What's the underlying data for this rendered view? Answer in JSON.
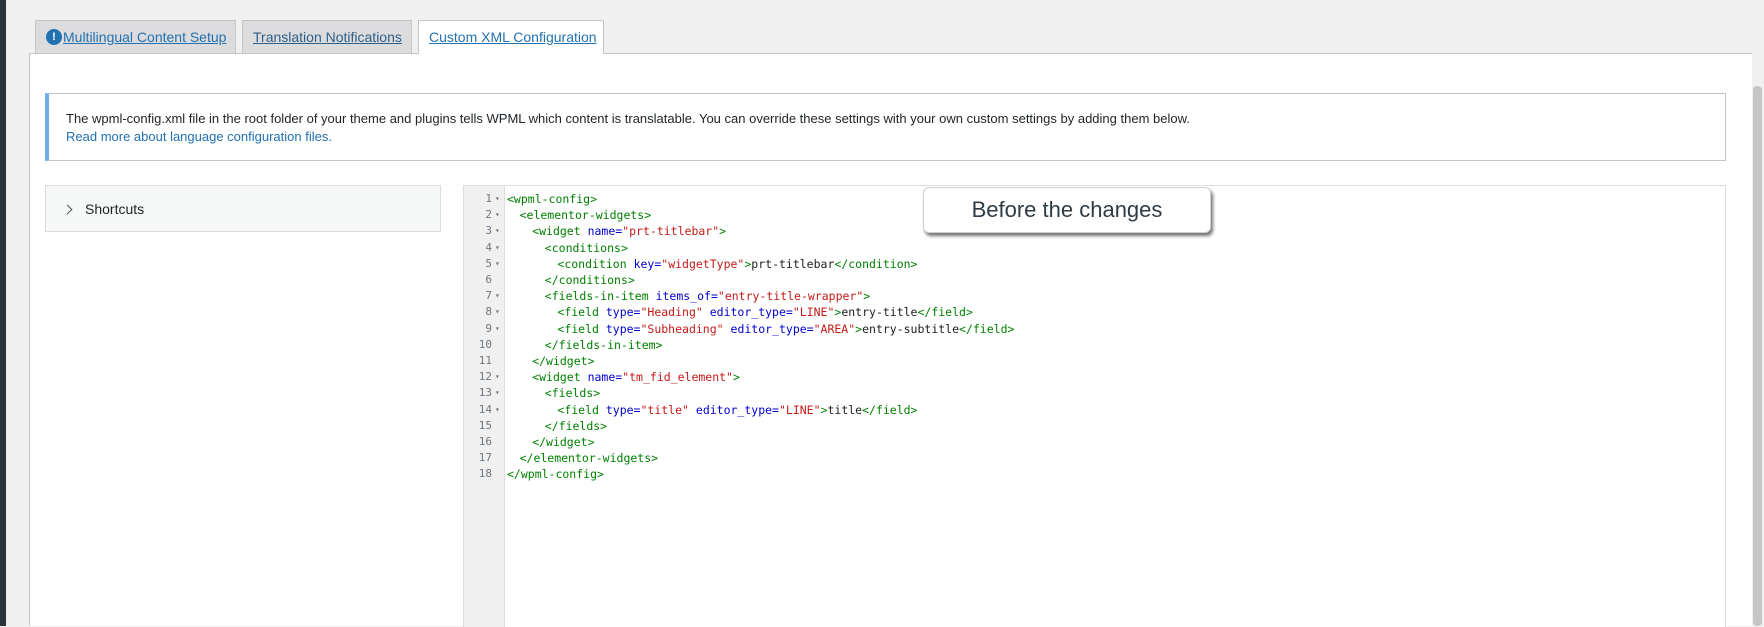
{
  "tabs": [
    {
      "label": "Multilingual Content Setup",
      "icon": "alert-icon",
      "active": false
    },
    {
      "label": "Translation Notifications",
      "active": false
    },
    {
      "label": "Custom XML Configuration",
      "active": true
    }
  ],
  "notice": {
    "message": "The wpml-config.xml file in the root folder of your theme and plugins tells WPML which content is translatable. You can override these settings with your own custom settings by adding them below.",
    "link": "Read more about language configuration files."
  },
  "shortcuts": {
    "label": "Shortcuts"
  },
  "callout": {
    "text": "Before the changes"
  },
  "editor": {
    "lines": [
      {
        "n": "1",
        "fold": true,
        "indent": 0,
        "tokens": [
          {
            "t": "tg",
            "v": "<wpml-config>"
          }
        ]
      },
      {
        "n": "2",
        "fold": true,
        "indent": 1,
        "tokens": [
          {
            "t": "tg",
            "v": "<elementor-widgets>"
          }
        ]
      },
      {
        "n": "3",
        "fold": true,
        "indent": 2,
        "tokens": [
          {
            "t": "tg",
            "v": "<widget "
          },
          {
            "t": "at",
            "v": "name="
          },
          {
            "t": "vl",
            "v": "\"prt-titlebar\""
          },
          {
            "t": "tg",
            "v": ">"
          }
        ]
      },
      {
        "n": "4",
        "fold": true,
        "indent": 3,
        "tokens": [
          {
            "t": "tg",
            "v": "<conditions>"
          }
        ]
      },
      {
        "n": "5",
        "fold": true,
        "indent": 4,
        "tokens": [
          {
            "t": "tg",
            "v": "<condition "
          },
          {
            "t": "at",
            "v": "key="
          },
          {
            "t": "vl",
            "v": "\"widgetType\""
          },
          {
            "t": "tg",
            "v": ">"
          },
          {
            "t": "tx",
            "v": "prt-titlebar"
          },
          {
            "t": "tg",
            "v": "</condition>"
          }
        ]
      },
      {
        "n": "6",
        "fold": false,
        "indent": 3,
        "tokens": [
          {
            "t": "tg",
            "v": "</conditions>"
          }
        ]
      },
      {
        "n": "7",
        "fold": true,
        "indent": 3,
        "tokens": [
          {
            "t": "tg",
            "v": "<fields-in-item "
          },
          {
            "t": "at",
            "v": "items_of="
          },
          {
            "t": "vl",
            "v": "\"entry-title-wrapper\""
          },
          {
            "t": "tg",
            "v": ">"
          }
        ]
      },
      {
        "n": "8",
        "fold": true,
        "indent": 4,
        "tokens": [
          {
            "t": "tg",
            "v": "<field "
          },
          {
            "t": "at",
            "v": "type="
          },
          {
            "t": "vl",
            "v": "\"Heading\""
          },
          {
            "t": "tx",
            "v": " "
          },
          {
            "t": "at",
            "v": "editor_type="
          },
          {
            "t": "vl",
            "v": "\"LINE\""
          },
          {
            "t": "tg",
            "v": ">"
          },
          {
            "t": "tx",
            "v": "entry-title"
          },
          {
            "t": "tg",
            "v": "</field>"
          }
        ]
      },
      {
        "n": "9",
        "fold": true,
        "indent": 4,
        "tokens": [
          {
            "t": "tg",
            "v": "<field "
          },
          {
            "t": "at",
            "v": "type="
          },
          {
            "t": "vl",
            "v": "\"Subheading\""
          },
          {
            "t": "tx",
            "v": " "
          },
          {
            "t": "at",
            "v": "editor_type="
          },
          {
            "t": "vl",
            "v": "\"AREA\""
          },
          {
            "t": "tg",
            "v": ">"
          },
          {
            "t": "tx",
            "v": "entry-subtitle"
          },
          {
            "t": "tg",
            "v": "</field>"
          }
        ]
      },
      {
        "n": "10",
        "fold": false,
        "indent": 3,
        "tokens": [
          {
            "t": "tg",
            "v": "</fields-in-item>"
          }
        ]
      },
      {
        "n": "11",
        "fold": false,
        "indent": 2,
        "tokens": [
          {
            "t": "tg",
            "v": "</widget>"
          }
        ]
      },
      {
        "n": "12",
        "fold": true,
        "indent": 2,
        "tokens": [
          {
            "t": "tg",
            "v": "<widget "
          },
          {
            "t": "at",
            "v": "name="
          },
          {
            "t": "vl",
            "v": "\"tm_fid_element\""
          },
          {
            "t": "tg",
            "v": ">"
          }
        ]
      },
      {
        "n": "13",
        "fold": true,
        "indent": 3,
        "tokens": [
          {
            "t": "tg",
            "v": "<fields>"
          }
        ]
      },
      {
        "n": "14",
        "fold": true,
        "indent": 4,
        "tokens": [
          {
            "t": "tg",
            "v": "<field "
          },
          {
            "t": "at",
            "v": "type="
          },
          {
            "t": "vl",
            "v": "\"title\""
          },
          {
            "t": "tx",
            "v": " "
          },
          {
            "t": "at",
            "v": "editor_type="
          },
          {
            "t": "vl",
            "v": "\"LINE\""
          },
          {
            "t": "tg",
            "v": ">"
          },
          {
            "t": "tx",
            "v": "title"
          },
          {
            "t": "tg",
            "v": "</field>"
          }
        ]
      },
      {
        "n": "15",
        "fold": false,
        "indent": 3,
        "tokens": [
          {
            "t": "tg",
            "v": "</fields>"
          }
        ]
      },
      {
        "n": "16",
        "fold": false,
        "indent": 2,
        "tokens": [
          {
            "t": "tg",
            "v": "</widget>"
          }
        ]
      },
      {
        "n": "17",
        "fold": false,
        "indent": 1,
        "tokens": [
          {
            "t": "tg",
            "v": "</elementor-widgets>"
          }
        ]
      },
      {
        "n": "18",
        "fold": false,
        "indent": 0,
        "tokens": [
          {
            "t": "tg",
            "v": "</wpml-config>"
          }
        ]
      }
    ]
  }
}
